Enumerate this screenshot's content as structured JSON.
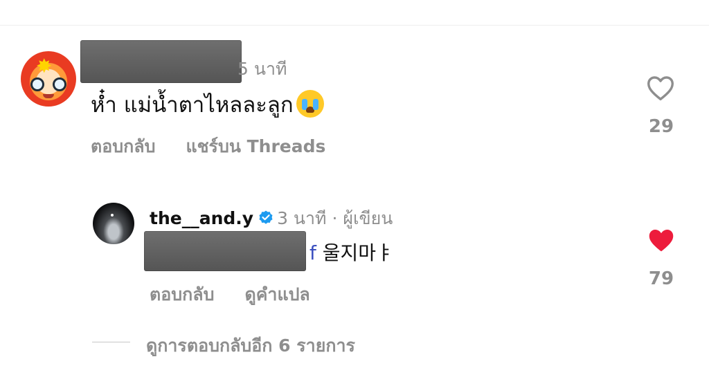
{
  "comments": [
    {
      "time_suffix": "5 นาที",
      "text": "ห๋ำ แม่น้ำตาไหลละลูก",
      "emoji": "loudly-crying-face",
      "actions": [
        "ตอบกลับ",
        "แชร์บน Threads"
      ],
      "like_count": "29",
      "liked": false
    },
    {
      "username": "the__and.y",
      "verified": true,
      "meta": "3 นาที · ผู้เขียน",
      "mention_tail": "f",
      "text": "울지마ㅑ",
      "actions": [
        "ตอบกลับ",
        "ดูคำแปล"
      ],
      "like_count": "79",
      "liked": true
    }
  ],
  "view_more_replies": "ดูการตอบกลับอีก 6 รายการ",
  "colors": {
    "muted": "#8e8e8e",
    "liked_heart": "#ed1c3c",
    "verified": "#1d9bf0",
    "mention": "#3b4fbf"
  }
}
